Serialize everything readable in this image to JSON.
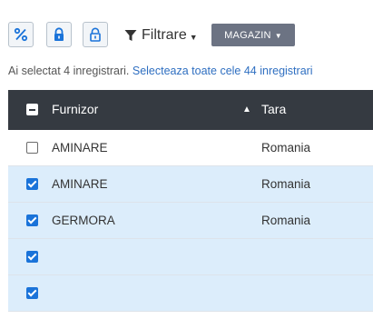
{
  "toolbar": {
    "icons": [
      "percent-icon",
      "lock-icon",
      "unlock-icon"
    ],
    "filter_label": "Filtrare",
    "store_label": "MAGAZIN"
  },
  "selection": {
    "text": "Ai selectat 4 inregistrari. ",
    "select_all_link": "Selecteaza toate cele 44 inregistrari"
  },
  "columns": {
    "supplier": "Furnizor",
    "country": "Tara"
  },
  "rows": [
    {
      "supplier": "AMINARE",
      "country": "Romania",
      "checked": false
    },
    {
      "supplier": "AMINARE",
      "country": "Romania",
      "checked": true
    },
    {
      "supplier": "GERMORA",
      "country": "Romania",
      "checked": true
    },
    {
      "supplier": "",
      "country": "",
      "checked": true
    },
    {
      "supplier": "",
      "country": "",
      "checked": true
    }
  ],
  "colors": {
    "accent": "#1a73d9",
    "header_bg": "#353a41",
    "selected_row_bg": "#dcedfb",
    "link": "#2f6fc1"
  }
}
